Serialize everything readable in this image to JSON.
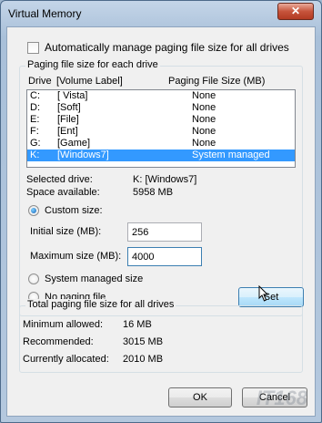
{
  "window": {
    "title": "Virtual Memory",
    "close_glyph": "✕"
  },
  "auto_manage": {
    "label": "Automatically manage paging file size for all drives",
    "checked": false
  },
  "per_drive": {
    "group_label": "Paging file size for each drive",
    "headers": {
      "drive": "Drive",
      "volume": "[Volume Label]",
      "size": "Paging File Size (MB)"
    },
    "rows": [
      {
        "drive": "C:",
        "label": "[ Vista]",
        "size": "None",
        "selected": false
      },
      {
        "drive": "D:",
        "label": "[Soft]",
        "size": "None",
        "selected": false
      },
      {
        "drive": "E:",
        "label": "[File]",
        "size": "None",
        "selected": false
      },
      {
        "drive": "F:",
        "label": "[Ent]",
        "size": "None",
        "selected": false
      },
      {
        "drive": "G:",
        "label": "[Game]",
        "size": "None",
        "selected": false
      },
      {
        "drive": "K:",
        "label": "[Windows7]",
        "size": "System managed",
        "selected": true
      }
    ],
    "selected_drive_label": "Selected drive:",
    "selected_drive_value": "K:  [Windows7]",
    "space_label": "Space available:",
    "space_value": "5958 MB",
    "custom_size_label": "Custom size:",
    "initial_label": "Initial size (MB):",
    "initial_value": "256",
    "maximum_label": "Maximum size (MB):",
    "maximum_value": "4000",
    "system_managed_label": "System managed size",
    "no_paging_label": "No paging file",
    "set_button": "Set"
  },
  "totals": {
    "group_label": "Total paging file size for all drives",
    "min_label": "Minimum allowed:",
    "min_value": "16 MB",
    "recommended_label": "Recommended:",
    "recommended_value": "3015 MB",
    "allocated_label": "Currently allocated:",
    "allocated_value": "2010 MB"
  },
  "buttons": {
    "ok": "OK",
    "cancel": "Cancel"
  },
  "watermark": "IT168"
}
